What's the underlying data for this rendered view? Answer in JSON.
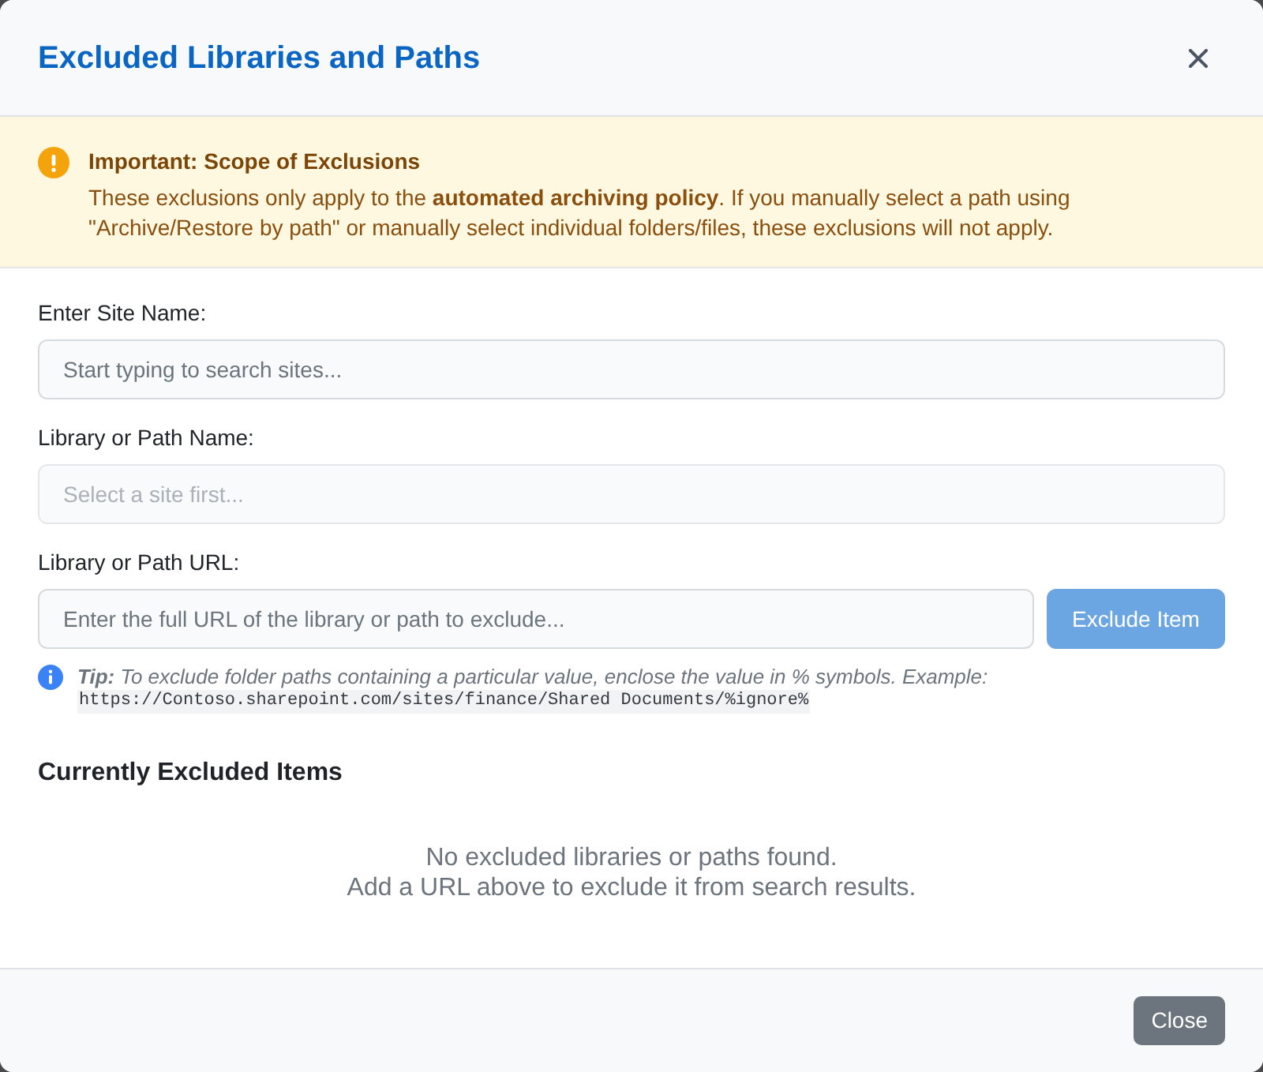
{
  "dialog": {
    "title": "Excluded Libraries and Paths"
  },
  "notice": {
    "title": "Important: Scope of Exclusions",
    "text": "These exclusions only apply to the **automated archiving policy**. If you manually select a path using \"Archive/Restore by path\" or manually select individual folders/files, these exclusions will not apply."
  },
  "fields": [
    {
      "label": "Enter Site Name:",
      "placeholder": "Start typing to search sites...",
      "disabled": false
    },
    {
      "label": "Library or Path Name:",
      "placeholder": "Select a site first...",
      "disabled": true
    },
    {
      "label": "Library or Path URL:",
      "placeholder": "Enter the full URL of the library or path to exclude...",
      "disabled": false,
      "button": {
        "label": "Exclude Item",
        "disabled": true
      }
    }
  ],
  "tip": {
    "text": "**Tip:** To exclude folder paths containing a particular value, enclose the value in % symbols. Example:",
    "example": "https://Contoso.sharepoint.com/sites/finance/Shared Documents/%ignore%"
  },
  "excluded": {
    "title": "Currently Excluded Items",
    "empty_message": [
      "No excluded libraries or paths found.",
      "Add a URL above to exclude it from search results."
    ]
  },
  "footer": {
    "buttons": [
      "Close"
    ]
  }
}
